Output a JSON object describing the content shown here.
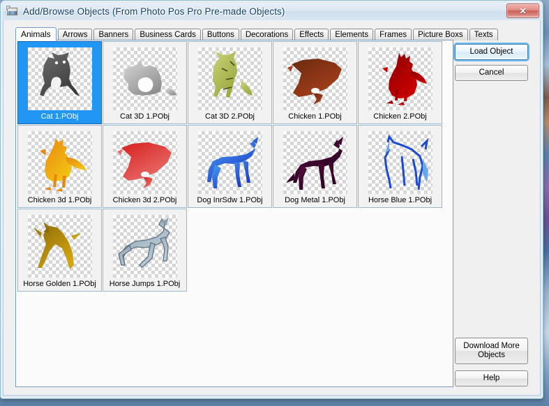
{
  "window": {
    "title": "Add/Browse Objects (From Photo Pos Pro Pre-made Objects)",
    "icon": "photo-object-icon",
    "close_label": "✕",
    "accent_selection_color": "#2196f3",
    "focus_color": "#3c7fb1",
    "close_color": "#c95f58"
  },
  "tabs": [
    {
      "label": "Animals",
      "selected": true
    },
    {
      "label": "Arrows",
      "selected": false
    },
    {
      "label": "Banners",
      "selected": false
    },
    {
      "label": "Business Cards",
      "selected": false
    },
    {
      "label": "Buttons",
      "selected": false
    },
    {
      "label": "Decorations",
      "selected": false
    },
    {
      "label": "Effects",
      "selected": false
    },
    {
      "label": "Elements",
      "selected": false
    },
    {
      "label": "Frames",
      "selected": false
    },
    {
      "label": "Picture Boxs",
      "selected": false
    },
    {
      "label": "Texts",
      "selected": false
    }
  ],
  "objects": [
    {
      "label": "Cat 1.PObj",
      "shape": "cat-sitting",
      "selected": true,
      "color": "#3a3a3a",
      "color2": "#6e6e6e"
    },
    {
      "label": "Cat 3D 1.PObj",
      "shape": "cat-lying",
      "selected": false,
      "color": "#8f8f8f",
      "color2": "#d8d8d8"
    },
    {
      "label": "Cat 3D 2.PObj",
      "shape": "cat-standing",
      "selected": false,
      "color": "#9aa83c",
      "color2": "#c8d27a"
    },
    {
      "label": "Chicken 1.PObj",
      "shape": "chicken-lying",
      "selected": false,
      "color": "#a8401a",
      "color2": "#6a2a10"
    },
    {
      "label": "Chicken 2.PObj",
      "shape": "rooster",
      "selected": false,
      "color": "#cc0000",
      "color2": "#8b0000"
    },
    {
      "label": "Chicken 3d 1.PObj",
      "shape": "chicken-gold",
      "selected": false,
      "color": "#f2c413",
      "color2": "#e8870f"
    },
    {
      "label": "Chicken 3d 2.PObj",
      "shape": "chicken-lying",
      "selected": false,
      "color": "#e8706e",
      "color2": "#d6201c"
    },
    {
      "label": "Dog InrSdw 1.PObj",
      "shape": "dog-slim",
      "selected": false,
      "color": "#1a35cc",
      "color2": "#4ba8ee"
    },
    {
      "label": "Dog Metal 1.PObj",
      "shape": "dog-shepherd",
      "selected": false,
      "color": "#2a0020",
      "color2": "#55103f"
    },
    {
      "label": "Horse Blue 1.PObj",
      "shape": "horse-outline",
      "selected": false,
      "color": "#1a49d6",
      "color2": "#69a6ee"
    },
    {
      "label": "Horse Golden 1.PObj",
      "shape": "horse-rear",
      "selected": false,
      "color": "#d4a511",
      "color2": "#8a6a06"
    },
    {
      "label": "Horse Jumps 1.PObj",
      "shape": "horse-jump",
      "selected": false,
      "color": "#c3d2dc",
      "color2": "#8aa0ae"
    }
  ],
  "buttons": {
    "load_object": "Load Object",
    "cancel": "Cancel",
    "download_more": "Download More Objects",
    "help": "Help"
  }
}
